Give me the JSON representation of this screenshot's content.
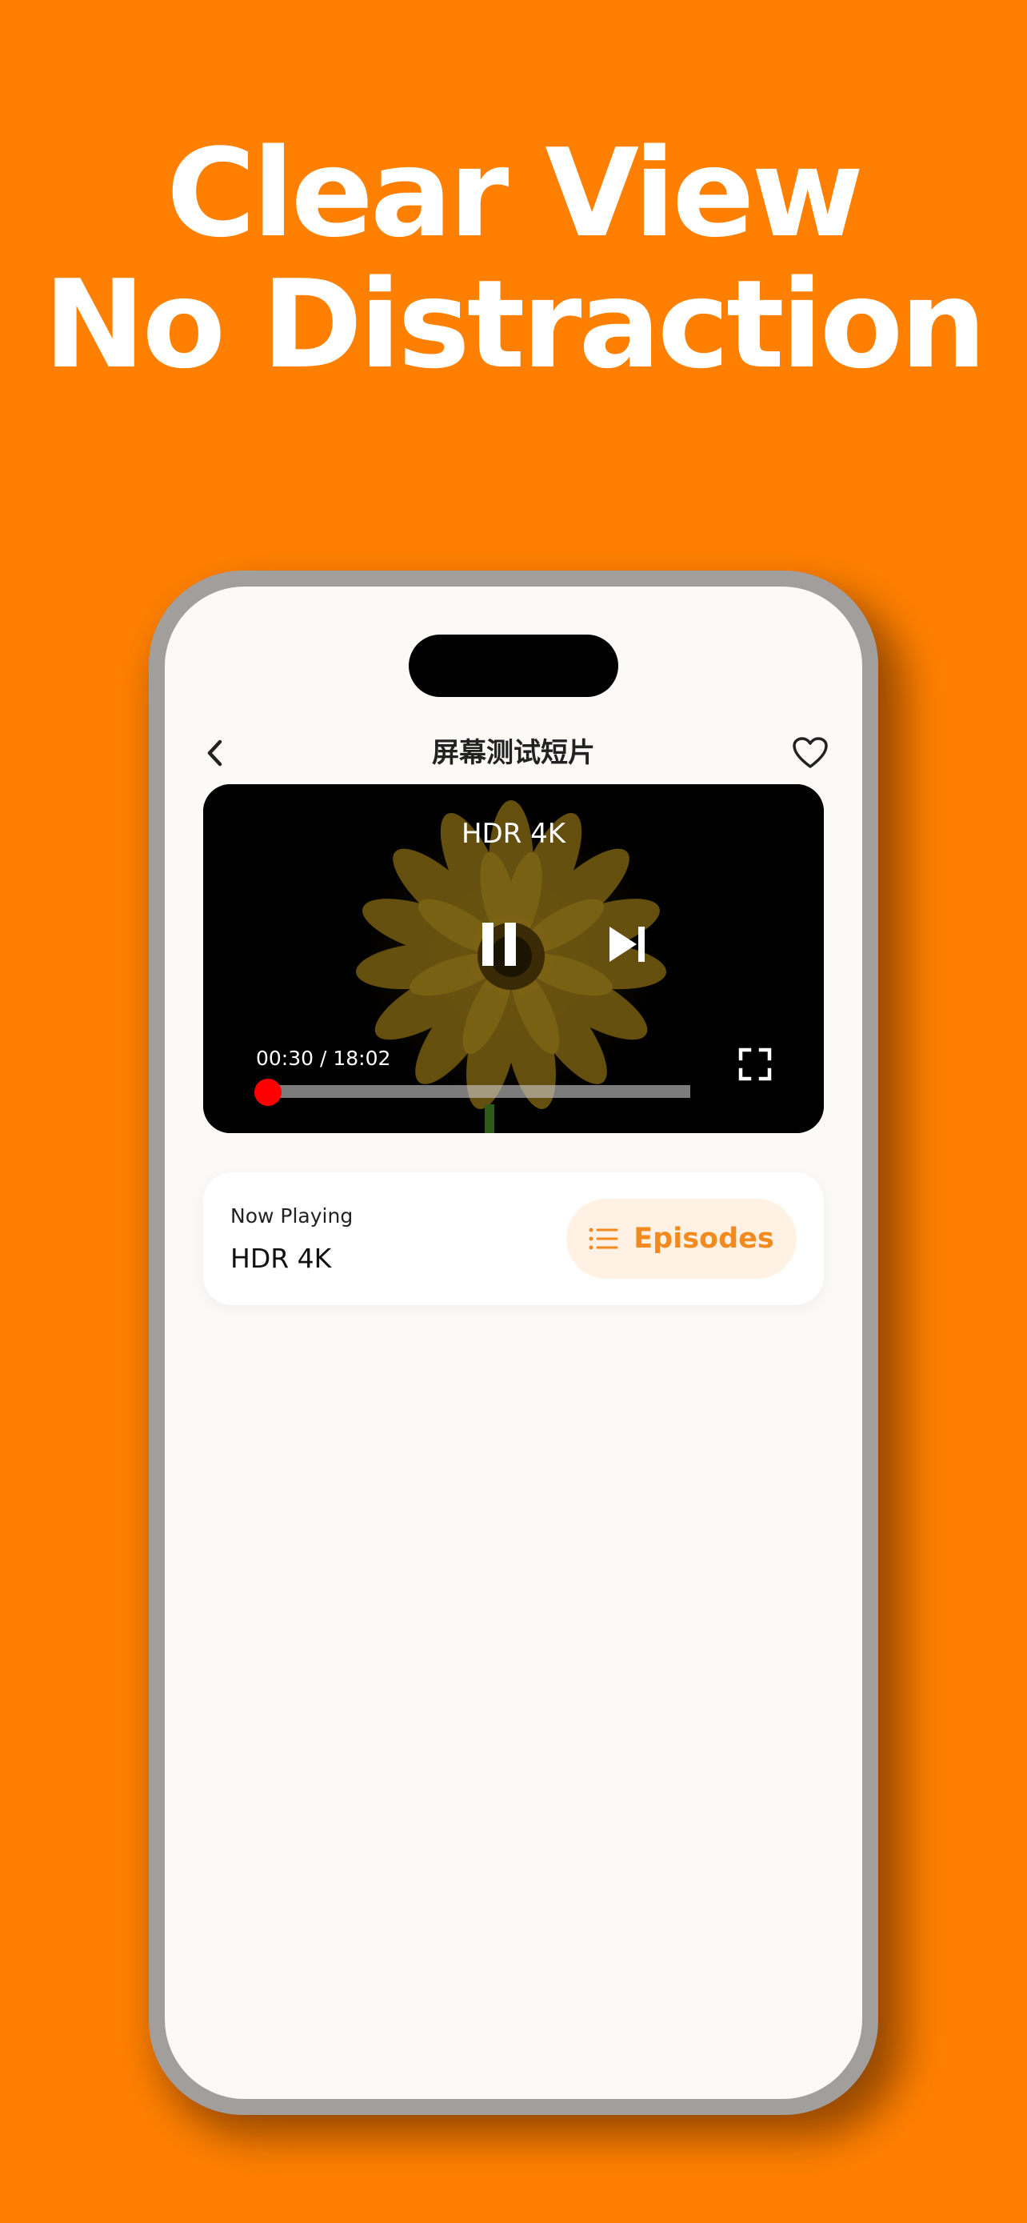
{
  "headline": {
    "line1": "Clear View",
    "line2": "No Distraction"
  },
  "nav": {
    "back_icon": "chevron-left-icon",
    "title": "屏幕测试短片",
    "favorite_icon": "heart-outline-icon"
  },
  "player": {
    "title": "HDR 4K",
    "current_time": "00:30",
    "duration": "18:02",
    "time_text": "00:30 / 18:02",
    "progress_fraction": 0.028,
    "pause_icon": "pause-icon",
    "next_icon": "skip-next-icon",
    "fullscreen_icon": "fullscreen-icon"
  },
  "now_playing": {
    "label": "Now Playing",
    "title": "HDR 4K",
    "episodes_icon": "list-icon",
    "episodes_label": "Episodes"
  },
  "colors": {
    "background": "#FF8000",
    "accent": "#F28A1E",
    "accent_bg": "#FFF1E3",
    "progress": "#FF0000",
    "frame": "#A19E9C",
    "screen": "#FBFAF7"
  }
}
